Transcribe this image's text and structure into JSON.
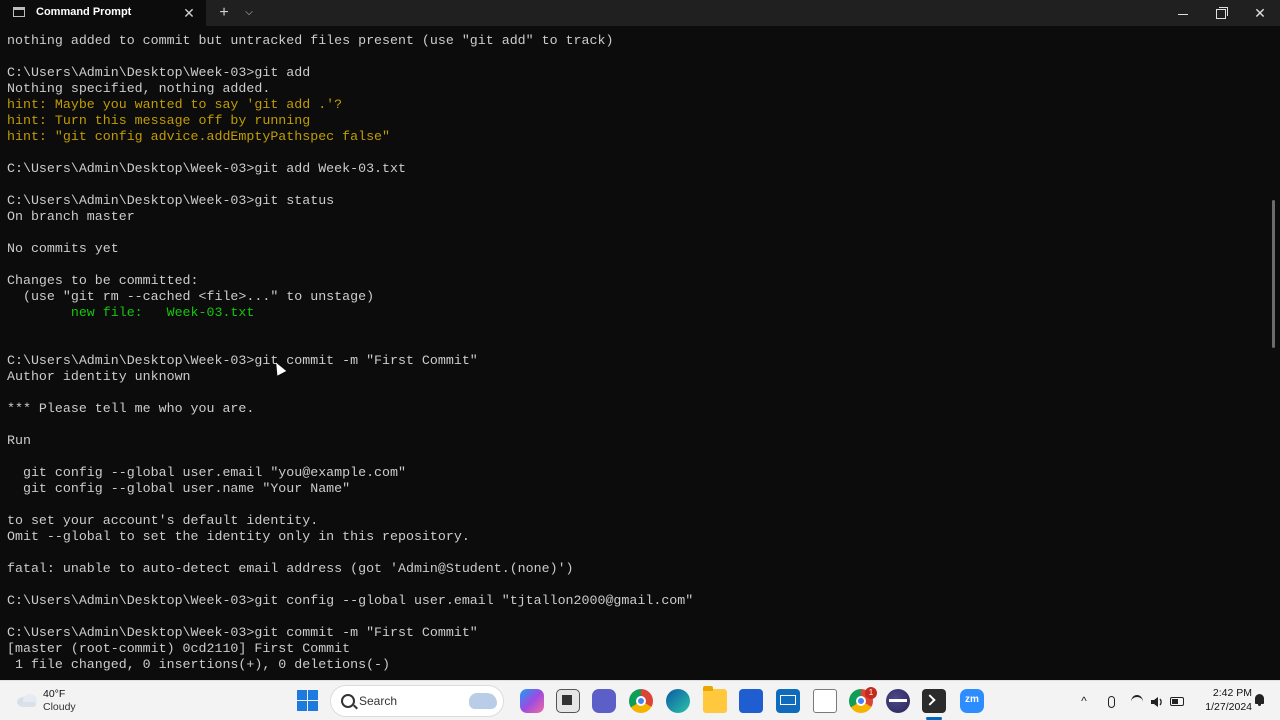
{
  "window": {
    "tab_title": "Command Prompt",
    "close_tab_glyph": "✕",
    "new_tab_glyph": "+",
    "dropdown_glyph": "⌵",
    "close_glyph": "✕"
  },
  "terminal": {
    "colors": {
      "background": "#0c0c0c",
      "text": "#cccccc",
      "hint": "#c19c00",
      "staged": "#16c60c"
    },
    "lines": [
      {
        "text": "nothing added to commit but untracked files present (use \"git add\" to track)",
        "color": "default"
      },
      {
        "text": "",
        "color": "default"
      },
      {
        "text": "C:\\Users\\Admin\\Desktop\\Week-03>git add",
        "color": "default"
      },
      {
        "text": "Nothing specified, nothing added.",
        "color": "default"
      },
      {
        "text": "hint: Maybe you wanted to say 'git add .'?",
        "color": "yellow"
      },
      {
        "text": "hint: Turn this message off by running",
        "color": "yellow"
      },
      {
        "text": "hint: \"git config advice.addEmptyPathspec false\"",
        "color": "yellow"
      },
      {
        "text": "",
        "color": "default"
      },
      {
        "text": "C:\\Users\\Admin\\Desktop\\Week-03>git add Week-03.txt",
        "color": "default"
      },
      {
        "text": "",
        "color": "default"
      },
      {
        "text": "C:\\Users\\Admin\\Desktop\\Week-03>git status",
        "color": "default"
      },
      {
        "text": "On branch master",
        "color": "default"
      },
      {
        "text": "",
        "color": "default"
      },
      {
        "text": "No commits yet",
        "color": "default"
      },
      {
        "text": "",
        "color": "default"
      },
      {
        "text": "Changes to be committed:",
        "color": "default"
      },
      {
        "text": "  (use \"git rm --cached <file>...\" to unstage)",
        "color": "default"
      },
      {
        "text": "        new file:   Week-03.txt",
        "color": "green"
      },
      {
        "text": "",
        "color": "default"
      },
      {
        "text": "",
        "color": "default"
      },
      {
        "text": "C:\\Users\\Admin\\Desktop\\Week-03>git commit -m \"First Commit\"",
        "color": "default"
      },
      {
        "text": "Author identity unknown",
        "color": "default"
      },
      {
        "text": "",
        "color": "default"
      },
      {
        "text": "*** Please tell me who you are.",
        "color": "default"
      },
      {
        "text": "",
        "color": "default"
      },
      {
        "text": "Run",
        "color": "default"
      },
      {
        "text": "",
        "color": "default"
      },
      {
        "text": "  git config --global user.email \"you@example.com\"",
        "color": "default"
      },
      {
        "text": "  git config --global user.name \"Your Name\"",
        "color": "default"
      },
      {
        "text": "",
        "color": "default"
      },
      {
        "text": "to set your account's default identity.",
        "color": "default"
      },
      {
        "text": "Omit --global to set the identity only in this repository.",
        "color": "default"
      },
      {
        "text": "",
        "color": "default"
      },
      {
        "text": "fatal: unable to auto-detect email address (got 'Admin@Student.(none)')",
        "color": "default"
      },
      {
        "text": "",
        "color": "default"
      },
      {
        "text": "C:\\Users\\Admin\\Desktop\\Week-03>git config --global user.email \"tjtallon2000@gmail.com\"",
        "color": "default"
      },
      {
        "text": "",
        "color": "default"
      },
      {
        "text": "C:\\Users\\Admin\\Desktop\\Week-03>git commit -m \"First Commit\"",
        "color": "default"
      },
      {
        "text": "[master (root-commit) 0cd2110] First Commit",
        "color": "default"
      },
      {
        "text": " 1 file changed, 0 insertions(+), 0 deletions(-)",
        "color": "default"
      }
    ]
  },
  "taskbar": {
    "weather": {
      "temp": "40°F",
      "desc": "Cloudy",
      "icon": "cloud-icon"
    },
    "search_label": "Search",
    "apps": [
      {
        "name": "copilot-icon"
      },
      {
        "name": "task-view-icon"
      },
      {
        "name": "teams-chat-icon"
      },
      {
        "name": "chrome-icon"
      },
      {
        "name": "edge-icon"
      },
      {
        "name": "file-explorer-icon"
      },
      {
        "name": "microsoft-store-icon"
      },
      {
        "name": "mail-icon"
      },
      {
        "name": "notepad-icon"
      },
      {
        "name": "chrome-profile-icon",
        "badge": "1"
      },
      {
        "name": "eclipse-icon"
      },
      {
        "name": "terminal-icon",
        "active": true
      },
      {
        "name": "zoom-icon",
        "label": "zm"
      }
    ],
    "tray": {
      "chevron": "^"
    },
    "clock": {
      "time": "2:42 PM",
      "date": "1/27/2024"
    },
    "accent": "#0067c0"
  }
}
